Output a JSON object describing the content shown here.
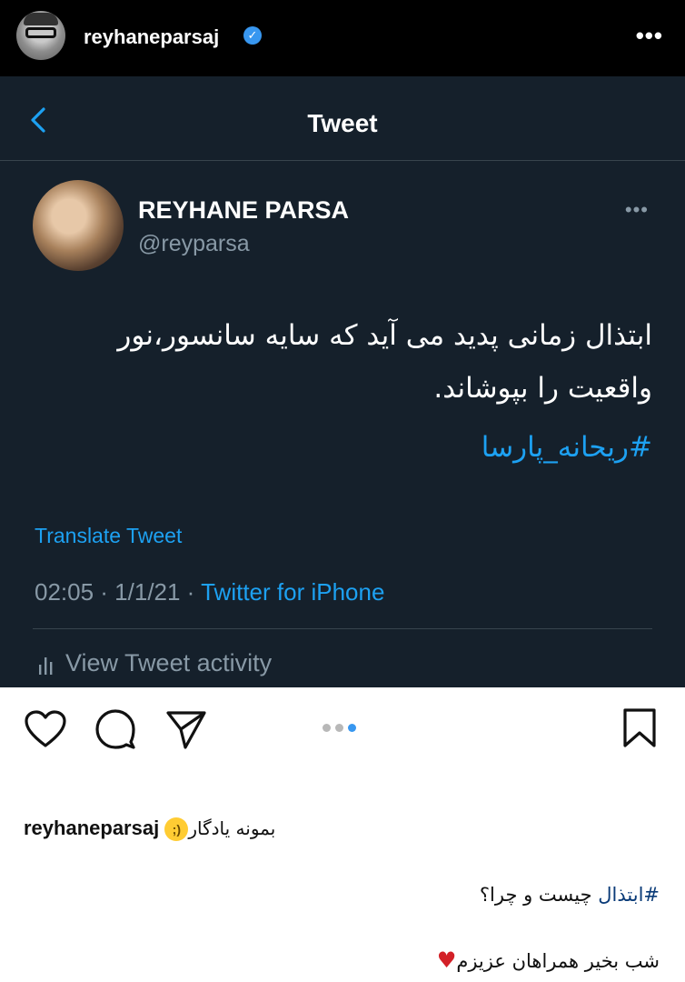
{
  "instagram": {
    "username": "reyhaneparsaj",
    "verified_icon": "verified-badge-icon",
    "more_label": "•••",
    "carousel": {
      "total": 3,
      "active": 3
    }
  },
  "tweet": {
    "nav_title": "Tweet",
    "author_name": "REYHANE PARSA",
    "author_handle": "@reyparsa",
    "more_label": "•••",
    "body_line1": "ابتذال زمانی پدید می آید که سایه سانسور،نور",
    "body_line2": "واقعیت را بپوشاند.",
    "hashtag": "#ریحانه_پارسا",
    "translate_label": "Translate Tweet",
    "timestamp": "02:05 · 1/1/21 · ",
    "source": "Twitter for iPhone",
    "activity_label": "View Tweet activity",
    "colors": {
      "background": "#15202b",
      "accent": "#1da1f2",
      "muted": "#8899a6"
    }
  },
  "caption": {
    "username": "reyhaneparsaj",
    "text": "بمونه یادگار",
    "emoji": "winking-face",
    "line2_tag": "#ابتذال",
    "line2_text": " چیست و چرا؟",
    "line3_text": "شب بخیر همراهان عزیزم",
    "line3_emoji": "red-heart"
  }
}
